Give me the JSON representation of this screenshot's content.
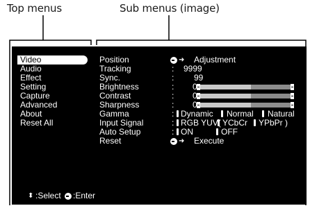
{
  "callouts": {
    "top_menus": "Top menus",
    "sub_menus": "Sub menus (image)"
  },
  "top_menu": {
    "items": [
      "Video",
      "Audio",
      "Effect",
      "Setting",
      "Capture",
      "Advanced",
      "About",
      "Reset All"
    ],
    "selected": "Video"
  },
  "sub_menu": {
    "labels": [
      "Position",
      "Tracking",
      "Sync.",
      "Brightness",
      "Contrast",
      "Sharpness",
      "Gamma",
      "Input Signal",
      "Auto Setup",
      "Reset"
    ],
    "colon": ":",
    "position_value": "Adjustment",
    "tracking_value": "9999",
    "sync_value": "99",
    "brightness_value": "0",
    "contrast_value": "0",
    "sharpness_value": "0",
    "gamma_options": [
      "Dynamic",
      "Normal",
      "Natural"
    ],
    "input_options": [
      "RGB YUV(",
      "YCbCr",
      "YPbPr )"
    ],
    "auto_setup_options": [
      "ON",
      "OFF"
    ],
    "reset_value": "Execute"
  },
  "footer": {
    "select": ":Select",
    "enter": ":Enter"
  },
  "colors": {
    "screen_bg": "#000000",
    "screen_text": "#ffffff",
    "slider_light": "#c8c8c8",
    "slider_dark": "#8c8c8c"
  },
  "icons": {
    "enter": "enter-icon",
    "updown": "updown-arrow-icon"
  }
}
